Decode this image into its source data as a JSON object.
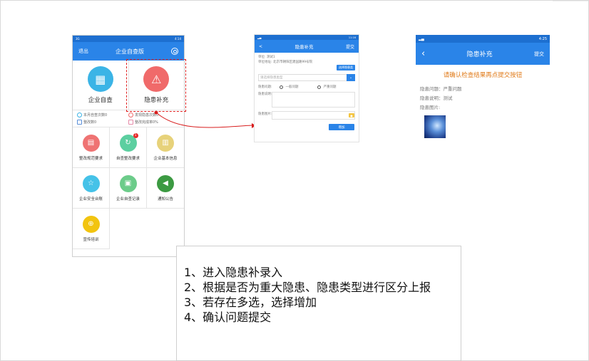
{
  "phone1": {
    "status_left": "3G",
    "status_right": "4:14",
    "header": {
      "logout": "退出",
      "title": "企业自查版"
    },
    "hero": [
      {
        "label": "企业自查",
        "color": "#3bb4e6"
      },
      {
        "label": "隐患补充",
        "color": "#f06a6a"
      }
    ],
    "stats": [
      {
        "text": "本月自查次数0",
        "color": "#3bb4e6"
      },
      {
        "text": "发现隐患次数0",
        "color": "#f06a6a"
      },
      {
        "text": "整改数0",
        "color": "#5a8fd8"
      },
      {
        "text": "整改完成率0%",
        "color": "#e58aa8"
      }
    ],
    "grid": [
      {
        "label": "整改规范要求",
        "color": "#ef7373",
        "badge": ""
      },
      {
        "label": "自查整改要求",
        "color": "#5ccfa0",
        "badge": "1"
      },
      {
        "label": "企业基本信息",
        "color": "#e7d27a",
        "badge": ""
      },
      {
        "label": "企业安全台账",
        "color": "#45c2e8",
        "badge": ""
      },
      {
        "label": "企业自查记录",
        "color": "#6ccc8a",
        "badge": ""
      },
      {
        "label": "通知公告",
        "color": "#3c9a42",
        "badge": ""
      },
      {
        "label": "宣传培训",
        "color": "#f2c40f",
        "badge": ""
      }
    ]
  },
  "phone2": {
    "status_right": "11:16",
    "header": {
      "back": "<",
      "title": "隐患补充",
      "submit": "提交"
    },
    "unit_line": "单位: 测试1",
    "address_line": "单位地址: 北京市朝阳区建国路99号院",
    "select_btn": "选择隐患类",
    "select_placeholder": "请选择隐患类型",
    "problem_label": "隐患问题:",
    "radio_normal": "一般问题",
    "radio_serious": "严重问题",
    "desc_label": "隐患说明:",
    "image_label": "隐患图片:",
    "add_button": "增加"
  },
  "phone3": {
    "status_right": "4:25",
    "header": {
      "title": "隐患补充",
      "submit": "提交"
    },
    "notice": "请确认检查结果再点提交按钮",
    "problem": "隐患问题：严重问题",
    "desc": "隐患说明：测试",
    "image_label": "隐患图片:"
  },
  "notes": [
    "1、进入隐患补录入",
    "2、根据是否为重大隐患、隐患类型进行区分上报",
    "3、若存在多选，选择增加",
    "4、确认问题提交"
  ]
}
